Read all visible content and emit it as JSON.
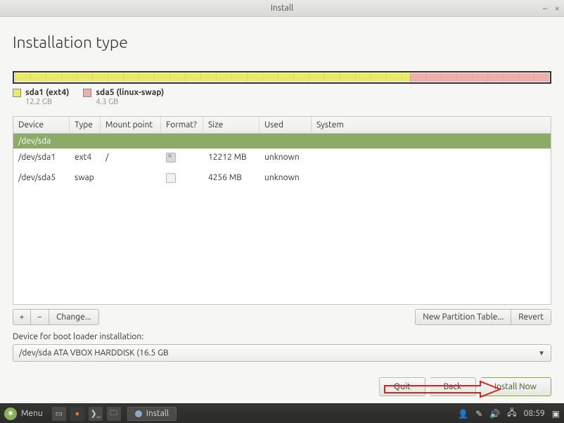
{
  "window": {
    "title": "Install"
  },
  "heading": "Installation type",
  "legend": [
    {
      "name": "sda1 (ext4)",
      "size": "12.2 GB",
      "swatch": "sw-yellow"
    },
    {
      "name": "sda5 (linux-swap)",
      "size": "4.3 GB",
      "swatch": "sw-pink"
    }
  ],
  "columns": {
    "device": "Device",
    "type": "Type",
    "mount": "Mount point",
    "format": "Format?",
    "size": "Size",
    "used": "Used",
    "system": "System"
  },
  "group": "/dev/sda",
  "rows": [
    {
      "device": "/dev/sda1",
      "type": "ext4",
      "mount": "/",
      "format": true,
      "size": "12212 MB",
      "used": "unknown",
      "system": ""
    },
    {
      "device": "/dev/sda5",
      "type": "swap",
      "mount": "",
      "format": false,
      "size": "4256 MB",
      "used": "unknown",
      "system": ""
    }
  ],
  "toolbar": {
    "add": "+",
    "remove": "−",
    "change": "Change...",
    "newtable": "New Partition Table...",
    "revert": "Revert"
  },
  "bootloader": {
    "label": "Device for boot loader installation:",
    "value": "/dev/sda   ATA VBOX HARDDISK (16.5 GB"
  },
  "footer": {
    "quit": "Quit",
    "back": "Back",
    "install": "Install Now"
  },
  "taskbar": {
    "menu": "Menu",
    "active": "Install",
    "time": "08:59"
  }
}
